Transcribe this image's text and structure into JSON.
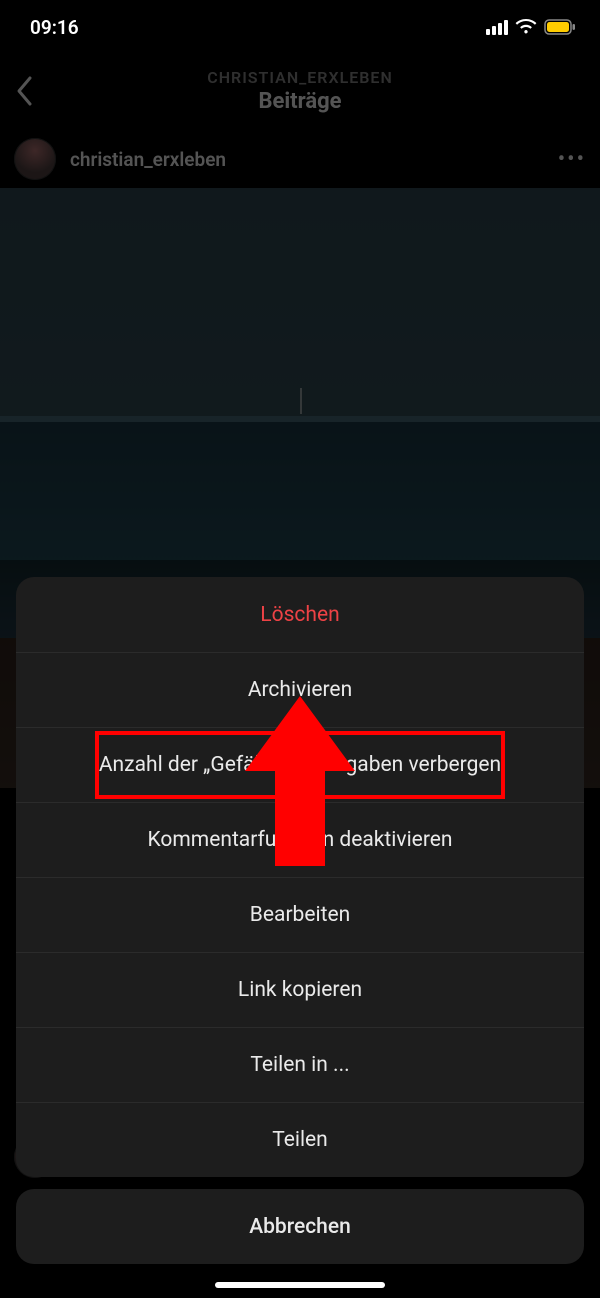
{
  "status": {
    "time": "09:16"
  },
  "header": {
    "subtitle": "CHRISTIAN_ERXLEBEN",
    "title": "Beiträge"
  },
  "post": {
    "owner": "christian_erxleben"
  },
  "sheet": {
    "delete": "Löschen",
    "archive": "Archivieren",
    "hide_likes": "Anzahl der „Gefällt mir\"-Angaben verbergen",
    "disable_comments": "Kommentarfunktion deaktivieren",
    "edit": "Bearbeiten",
    "copy_link": "Link kopieren",
    "share_in": "Teilen in ...",
    "share": "Teilen",
    "cancel": "Abbrechen"
  }
}
